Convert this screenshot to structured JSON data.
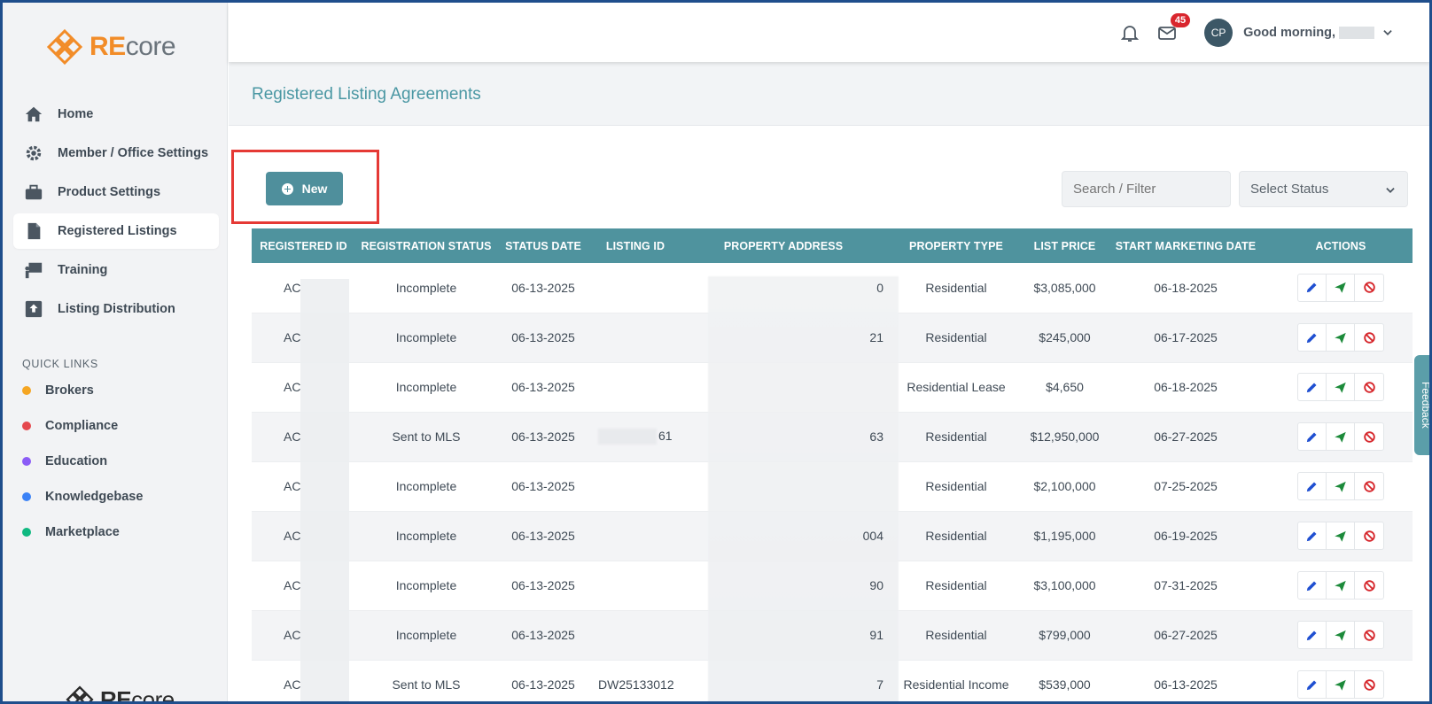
{
  "app": {
    "logo_re": "RE",
    "logo_core": "core"
  },
  "sidebar": {
    "items": [
      {
        "label": "Home",
        "icon": "home-icon"
      },
      {
        "label": "Member / Office Settings",
        "icon": "gear-icon"
      },
      {
        "label": "Product Settings",
        "icon": "briefcase-icon"
      },
      {
        "label": "Registered Listings",
        "icon": "document-icon",
        "active": true
      },
      {
        "label": "Training",
        "icon": "presentation-icon"
      },
      {
        "label": "Listing Distribution",
        "icon": "upload-icon"
      }
    ],
    "quick_links_title": "QUICK LINKS",
    "quick_links": [
      {
        "label": "Brokers",
        "color": "#f5a623"
      },
      {
        "label": "Compliance",
        "color": "#e5484d"
      },
      {
        "label": "Education",
        "color": "#8b5cf6"
      },
      {
        "label": "Knowledgebase",
        "color": "#3b82f6"
      },
      {
        "label": "Marketplace",
        "color": "#10b981"
      }
    ]
  },
  "header": {
    "mail_badge": "45",
    "avatar_initials": "CP",
    "greeting": "Good morning,"
  },
  "page": {
    "title": "Registered Listing Agreements"
  },
  "toolbar": {
    "new_label": "New",
    "search_placeholder": "Search / Filter",
    "status_select": "Select Status"
  },
  "table": {
    "columns": [
      "REGISTERED ID",
      "REGISTRATION STATUS",
      "STATUS DATE",
      "LISTING ID",
      "PROPERTY ADDRESS",
      "PROPERTY TYPE",
      "LIST PRICE",
      "START MARKETING DATE",
      "ACTIONS"
    ],
    "rows": [
      {
        "id": "AC",
        "status": "Incomplete",
        "date": "06-13-2025",
        "listing_id": "",
        "addr_tail": "0",
        "type": "Residential",
        "price": "$3,085,000",
        "start": "06-18-2025"
      },
      {
        "id": "AC",
        "status": "Incomplete",
        "date": "06-13-2025",
        "listing_id": "",
        "addr_tail": "21",
        "type": "Residential",
        "price": "$245,000",
        "start": "06-17-2025"
      },
      {
        "id": "AC",
        "status": "Incomplete",
        "date": "06-13-2025",
        "listing_id": "",
        "addr_tail": "",
        "type": "Residential Lease",
        "price": "$4,650",
        "start": "06-18-2025"
      },
      {
        "id": "AC",
        "status": "Sent to MLS",
        "date": "06-13-2025",
        "listing_id": "61",
        "addr_tail": "63",
        "type": "Residential",
        "price": "$12,950,000",
        "start": "06-27-2025"
      },
      {
        "id": "AC",
        "status": "Incomplete",
        "date": "06-13-2025",
        "listing_id": "",
        "addr_tail": "",
        "type": "Residential",
        "price": "$2,100,000",
        "start": "07-25-2025"
      },
      {
        "id": "AC",
        "status": "Incomplete",
        "date": "06-13-2025",
        "listing_id": "",
        "addr_tail": "004",
        "type": "Residential",
        "price": "$1,195,000",
        "start": "06-19-2025"
      },
      {
        "id": "AC",
        "status": "Incomplete",
        "date": "06-13-2025",
        "listing_id": "",
        "addr_tail": "90",
        "type": "Residential",
        "price": "$3,100,000",
        "start": "07-31-2025"
      },
      {
        "id": "AC",
        "status": "Incomplete",
        "date": "06-13-2025",
        "listing_id": "",
        "addr_tail": "91",
        "type": "Residential",
        "price": "$799,000",
        "start": "06-27-2025"
      },
      {
        "id": "AC",
        "status": "Sent to MLS",
        "date": "06-13-2025",
        "listing_id": "DW25133012",
        "addr_tail": "7",
        "type": "Residential Income",
        "price": "$539,000",
        "start": "06-13-2025"
      }
    ]
  },
  "feedback_label": "Feedback",
  "colors": {
    "accent": "#4f939e",
    "brand": "#f28c28",
    "highlight": "#e53935"
  }
}
